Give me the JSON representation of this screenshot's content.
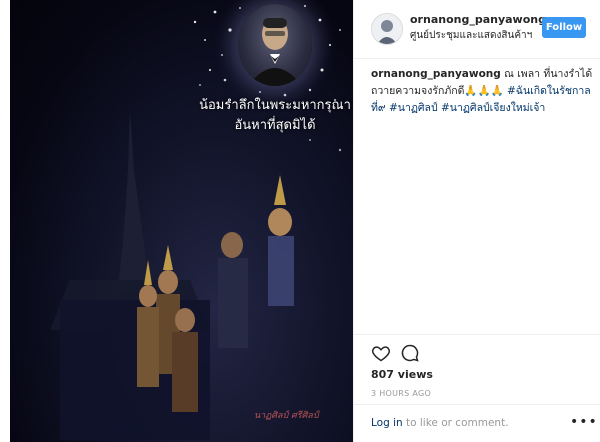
{
  "media": {
    "caption_lines": [
      "น้อมรำลึกในพระมหากรุณา",
      "อันหาที่สุดมิได้"
    ],
    "watermark": "นาฏศิลป์ ศรีศิลป์",
    "background_color": "#0b0c1c"
  },
  "post": {
    "username": "ornanong_panyawong",
    "location": "ศูนย์ประชุมและแสดงสินค้าฯ",
    "follow_label": "Follow",
    "follow_color": "#3897f0",
    "comment": {
      "username": "ornanong_panyawong",
      "text": "ณ เพลา ที่นางรำได้ถวายความจงรักภักดี",
      "emoji": "🙏🙏🙏",
      "tags": [
        "#ฉันเกิดในรัชกาลที่๙",
        "#นาฏศิลป์",
        "#นาฏศิลป์เจียงใหม่เจ้า"
      ]
    },
    "views": "807 views",
    "timestamp": "3 HOURS AGO",
    "login_link": "Log in",
    "login_text": " to like or comment.",
    "more_icon": "more-options-icon",
    "heart_icon": "heart-icon",
    "comment_icon": "comment-bubble-icon"
  }
}
